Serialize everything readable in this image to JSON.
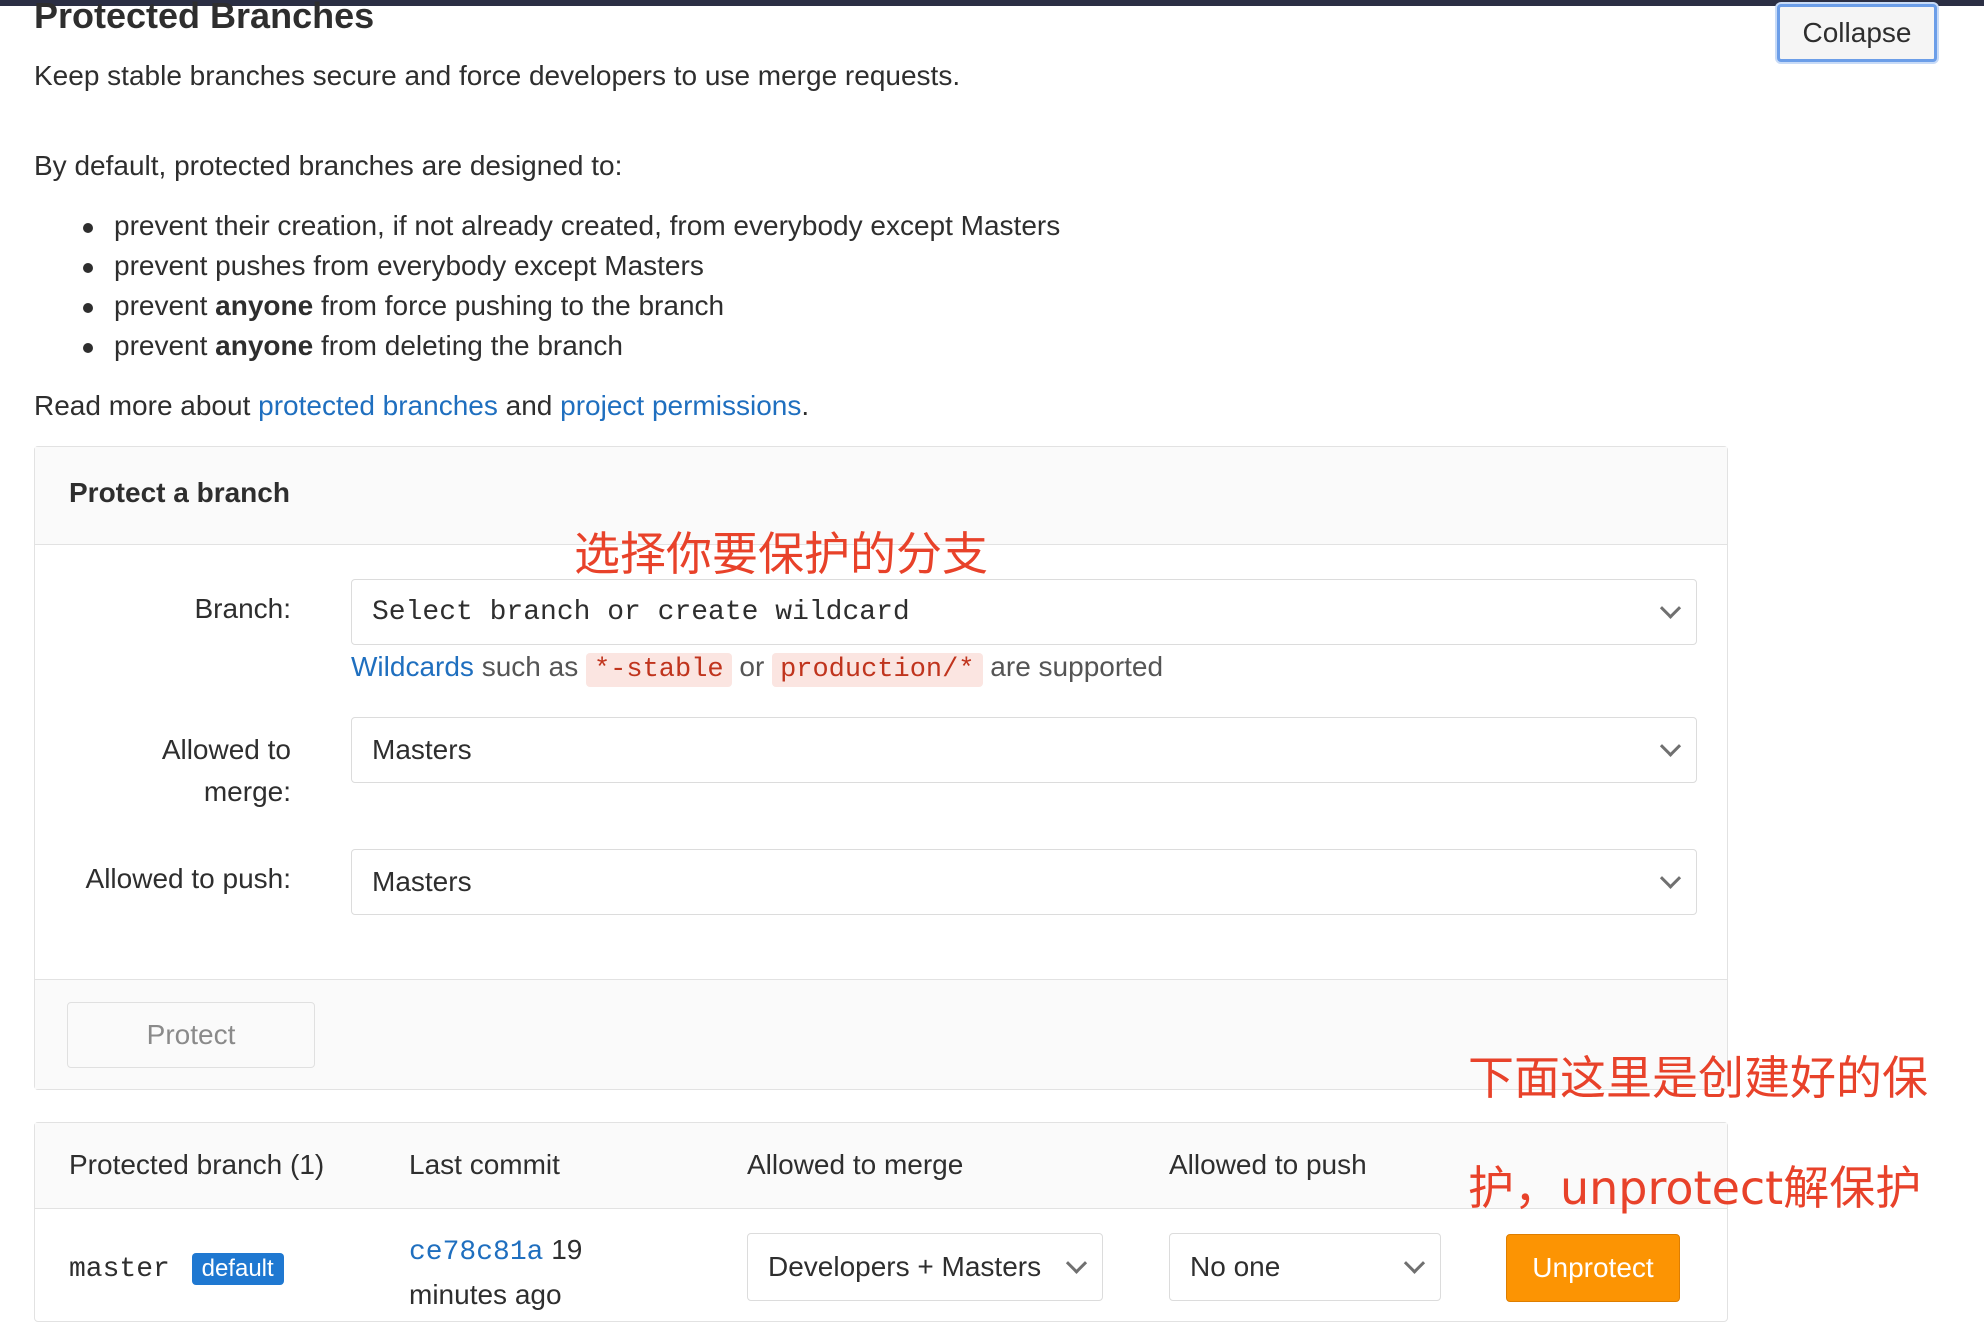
{
  "page": {
    "heading": "Protected Branches",
    "intro": "Keep stable branches secure and force developers to use merge requests.",
    "collapse_label": "Collapse",
    "defaults_heading": "By default, protected branches are designed to:",
    "bullets": [
      {
        "pre": "prevent their creation, if not already created, from everybody except Masters",
        "bold": "",
        "post": ""
      },
      {
        "pre": "prevent pushes from everybody except Masters",
        "bold": "",
        "post": ""
      },
      {
        "pre": "prevent ",
        "bold": "anyone",
        "post": " from force pushing to the branch"
      },
      {
        "pre": "prevent ",
        "bold": "anyone",
        "post": " from deleting the branch"
      }
    ],
    "read_more": {
      "prefix": "Read more about ",
      "link1": "protected branches",
      "middle": " and ",
      "link2": "project permissions",
      "suffix": "."
    }
  },
  "protect_form": {
    "title": "Protect a branch",
    "branch_label": "Branch:",
    "branch_placeholder": "Select branch or create wildcard",
    "help": {
      "link": "Wildcards",
      "text1": " such as ",
      "code1": "*-stable",
      "text2": " or ",
      "code2": "production/*",
      "text3": " are supported"
    },
    "merge_label_line1": "Allowed to",
    "merge_label_line2": "merge:",
    "merge_value": "Masters",
    "push_label": "Allowed to push:",
    "push_value": "Masters",
    "protect_button": "Protect"
  },
  "annotations": {
    "select_branch": "选择你要保护的分支",
    "created_line1": "下面这里是创建好的保",
    "created_line2": "护，unprotect解保护",
    "color": "#e8422a"
  },
  "table": {
    "headers": {
      "branch": "Protected branch (1)",
      "commit": "Last commit",
      "merge": "Allowed to merge",
      "push": "Allowed to push"
    },
    "rows": [
      {
        "branch": "master",
        "badge": "default",
        "commit_sha": "ce78c81a",
        "commit_time1": " 19",
        "commit_time2": "minutes ago",
        "merge": "Developers + Masters",
        "push": "No one",
        "action": "Unprotect"
      }
    ]
  },
  "colors": {
    "link": "#1f6fbf",
    "badge": "#1f78d1",
    "unprotect": "#fc9403"
  }
}
